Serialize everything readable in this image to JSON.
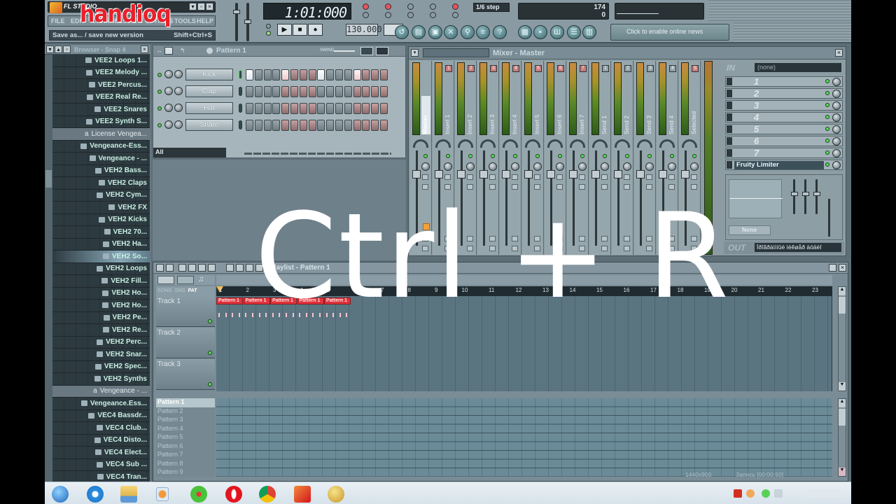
{
  "app": {
    "name": "FL STUDIO",
    "watermark": "handioq",
    "menu": [
      "FILE",
      "EDIT",
      "CHANNELS",
      "VIEW",
      "OPTIONS",
      "TOOLS",
      "HELP"
    ],
    "hint": {
      "text": "Save as... / save new version",
      "shortcut": "Shift+Ctrl+S"
    }
  },
  "transport": {
    "time": "1:01:000",
    "tempo": "130.000",
    "step_selector": "1/6 step",
    "mode_labels": {
      "pattern": "PAT",
      "song": "SONG"
    },
    "cpu": {
      "value": "174",
      "poly": "0"
    },
    "news_text": "Click to enable online news"
  },
  "browser": {
    "title": "Browser - Snap 4",
    "items": [
      {
        "label": "VEE2 Loops 1...",
        "type": "folder",
        "level": 3
      },
      {
        "label": "VEE2 Melody ...",
        "type": "folder",
        "level": 3
      },
      {
        "label": "VEE2 Percus...",
        "type": "folder",
        "level": 3
      },
      {
        "label": "VEE2 Real Re...",
        "type": "folder",
        "level": 3
      },
      {
        "label": "VEE2 Snares",
        "type": "folder",
        "level": 3
      },
      {
        "label": "VEE2 Synth S...",
        "type": "folder",
        "level": 3
      },
      {
        "label": "License Vengea...",
        "type": "license",
        "level": 2
      },
      {
        "label": "Vengeance-Ess...",
        "type": "folder",
        "level": 1
      },
      {
        "label": "Vengeance - ...",
        "type": "folder",
        "level": 2
      },
      {
        "label": "VEH2 Bass...",
        "type": "folder",
        "level": 3
      },
      {
        "label": "VEH2 Claps",
        "type": "folder",
        "level": 3
      },
      {
        "label": "VEH2 Cym...",
        "type": "folder",
        "level": 3
      },
      {
        "label": "VEH2 FX",
        "type": "folder",
        "level": 3
      },
      {
        "label": "VEH2 Kicks",
        "type": "folder",
        "level": 3
      },
      {
        "label": "VEH2 70...",
        "type": "folder",
        "level": 4
      },
      {
        "label": "VEH2 Ha...",
        "type": "folder",
        "level": 4
      },
      {
        "label": "VEH2 So...",
        "type": "folder",
        "level": 4,
        "selected": true
      },
      {
        "label": "VEH2 Loops",
        "type": "folder",
        "level": 3
      },
      {
        "label": "VEH2 Fill...",
        "type": "folder",
        "level": 4
      },
      {
        "label": "VEH2 Ho...",
        "type": "folder",
        "level": 4
      },
      {
        "label": "VEH2 Ho...",
        "type": "folder",
        "level": 4
      },
      {
        "label": "VEH2 Pe...",
        "type": "folder",
        "level": 4
      },
      {
        "label": "VEH2 Re...",
        "type": "folder",
        "level": 4
      },
      {
        "label": "VEH2 Perc...",
        "type": "folder",
        "level": 3
      },
      {
        "label": "VEH2 Snar...",
        "type": "folder",
        "level": 3
      },
      {
        "label": "VEH2 Spec...",
        "type": "folder",
        "level": 3
      },
      {
        "label": "VEH2 Synths",
        "type": "folder",
        "level": 3
      },
      {
        "label": "Vengeance - ...",
        "type": "license",
        "level": 2
      },
      {
        "label": "Vengeance.Ess...",
        "type": "folder",
        "level": 1
      },
      {
        "label": "VEC4 Bassdr...",
        "type": "folder",
        "level": 2
      },
      {
        "label": "VEC4 Club...",
        "type": "folder",
        "level": 3
      },
      {
        "label": "VEC4 Disto...",
        "type": "folder",
        "level": 3
      },
      {
        "label": "VEC4 Elect...",
        "type": "folder",
        "level": 3
      },
      {
        "label": "VEC4 Sub ...",
        "type": "folder",
        "level": 3
      },
      {
        "label": "VEC4 Tran...",
        "type": "folder",
        "level": 3
      }
    ]
  },
  "channel_rack": {
    "title": "Pattern 1",
    "swing_label": "SWING",
    "filter": "All",
    "channels": [
      {
        "name": "Kick",
        "steps_on": [
          1,
          5,
          9,
          13
        ]
      },
      {
        "name": "Clap",
        "steps_on": []
      },
      {
        "name": "Hat",
        "steps_on": []
      },
      {
        "name": "Snare",
        "steps_on": []
      }
    ],
    "step_count": 16
  },
  "mixer": {
    "title": "Mixer - Master",
    "strips": [
      {
        "label": "Master",
        "badge": ""
      },
      {
        "label": "Insert 1",
        "badge": "1",
        "kind": "INS"
      },
      {
        "label": "Insert 2",
        "badge": "2",
        "kind": "INS"
      },
      {
        "label": "Insert 3",
        "badge": "3",
        "kind": "INS"
      },
      {
        "label": "Insert 4",
        "badge": "4",
        "kind": "INS"
      },
      {
        "label": "Insert 5",
        "badge": "5",
        "kind": "INS"
      },
      {
        "label": "Insert 6",
        "badge": "6",
        "kind": "INS"
      },
      {
        "label": "Insert 7",
        "badge": "7",
        "kind": "INS"
      },
      {
        "label": "Send 1",
        "badge": "1",
        "kind": "SND"
      },
      {
        "label": "Send 2",
        "badge": "2",
        "kind": "SND"
      },
      {
        "label": "Send 3",
        "badge": "3",
        "kind": "SND"
      },
      {
        "label": "Send 4",
        "badge": "4",
        "kind": "SND"
      },
      {
        "label": "Selected",
        "badge": "S"
      }
    ],
    "fx": {
      "in_label": "IN",
      "in_value": "(none)",
      "slots": [
        "1",
        "2",
        "3",
        "4",
        "5",
        "6",
        "7"
      ],
      "active_plugin": "Fruity Limiter",
      "plugin_preset": "None",
      "out_label": "OUT",
      "out_value": "Ïðîãðàììíûé ìèêøåð àóäèî"
    }
  },
  "playlist": {
    "title": "Playlist - Pattern 1",
    "mode_tabs": [
      "SONG",
      "SNG",
      "PAT"
    ],
    "ruler": [
      "1",
      "2",
      "3",
      "4",
      "5",
      "6",
      "7",
      "8",
      "9",
      "10",
      "11",
      "12",
      "13",
      "14",
      "15",
      "16",
      "17",
      "18",
      "19",
      "20",
      "21",
      "22",
      "23"
    ],
    "tracks": [
      "Track 1",
      "Track 2",
      "Track 3"
    ],
    "clips": [
      "Pattern 1",
      "Pattern 1",
      "Pattern 1",
      "Pattern 1",
      "Pattern 1"
    ],
    "patterns": [
      "Pattern 1",
      "Pattern 2",
      "Pattern 3",
      "Pattern 4",
      "Pattern 5",
      "Pattern 6",
      "Pattern 7",
      "Pattern 8",
      "Pattern 9"
    ],
    "status": {
      "resolution": "1440x900",
      "recording": "Запись [00:00:50]"
    }
  },
  "overlay": {
    "text": "Ctrl + R"
  },
  "taskbar": {
    "apps": [
      "start-orb",
      "internet-explorer",
      "file-explorer",
      "media-player",
      "icq",
      "opera",
      "chrome",
      "app-red",
      "fl-studio"
    ]
  }
}
